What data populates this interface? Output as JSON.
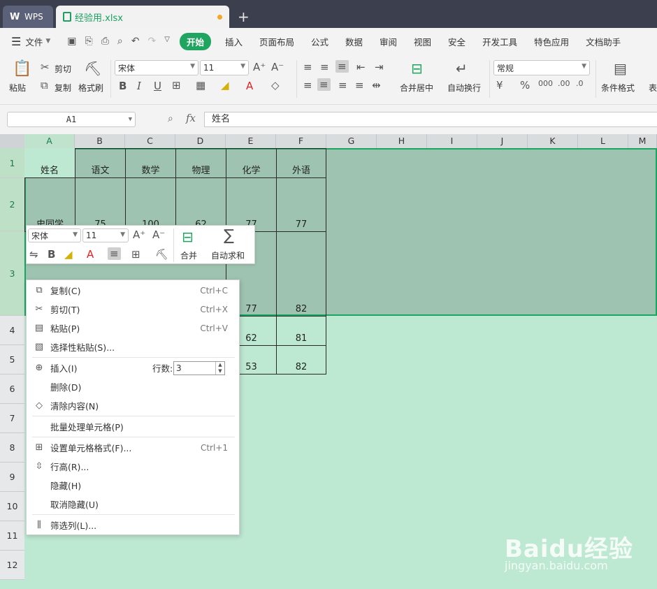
{
  "titlebar": {
    "wps_tab": "WPS",
    "doc_tab": "经验用.xlsx",
    "add_tab": "+"
  },
  "menubar": {
    "file": "文件",
    "start": "开始",
    "items": [
      "插入",
      "页面布局",
      "公式",
      "数据",
      "审阅",
      "视图",
      "安全",
      "开发工具",
      "特色应用",
      "文档助手"
    ]
  },
  "ribbon": {
    "paste": "粘贴",
    "cut": "剪切",
    "copy": "复制",
    "format_painter": "格式刷",
    "font_name": "宋体",
    "font_size": "11",
    "merge_center": "合并居中",
    "wrap_text": "自动换行",
    "number_format": "常规",
    "conditional_format": "条件格式",
    "table_style_partial": "表"
  },
  "formula_bar": {
    "name_box": "A1",
    "fx": "fx",
    "content": "姓名"
  },
  "columns": [
    "A",
    "B",
    "C",
    "D",
    "E",
    "F",
    "G",
    "H",
    "I",
    "J",
    "K",
    "L",
    "M"
  ],
  "rows": [
    "1",
    "2",
    "3",
    "4",
    "5",
    "6",
    "7",
    "8",
    "9",
    "10",
    "11",
    "12"
  ],
  "cells": {
    "headers": [
      "姓名",
      "语文",
      "数学",
      "物理",
      "化学",
      "外语"
    ],
    "row2_partial": [
      "史同学",
      "75",
      "100",
      "62",
      "77",
      "77"
    ],
    "e3": "77",
    "f3": "82",
    "e4": "62",
    "f4": "81",
    "e5": "53",
    "f5": "82"
  },
  "mini_toolbar": {
    "font_name": "宋体",
    "font_size": "11",
    "merge": "合并",
    "autosum": "自动求和"
  },
  "context_menu": {
    "copy": {
      "label": "复制(C)",
      "shortcut": "Ctrl+C"
    },
    "cut": {
      "label": "剪切(T)",
      "shortcut": "Ctrl+X"
    },
    "paste": {
      "label": "粘贴(P)",
      "shortcut": "Ctrl+V"
    },
    "paste_special": {
      "label": "选择性粘贴(S)..."
    },
    "insert": {
      "label": "插入(I)",
      "rows_label": "行数:",
      "rows_value": "3"
    },
    "delete": {
      "label": "删除(D)"
    },
    "clear": {
      "label": "清除内容(N)"
    },
    "batch": {
      "label": "批量处理单元格(P)"
    },
    "format_cells": {
      "label": "设置单元格格式(F)...",
      "shortcut": "Ctrl+1"
    },
    "row_height": {
      "label": "行高(R)..."
    },
    "hide": {
      "label": "隐藏(H)"
    },
    "unhide": {
      "label": "取消隐藏(U)"
    },
    "filter": {
      "label": "筛选列(L)..."
    }
  },
  "watermark": {
    "line1": "Baidu经验",
    "line2": "jingyan.baidu.com"
  },
  "colors": {
    "accent": "#20a561",
    "sheet_bg": "#bde8d1",
    "selection": "#9ec3b0"
  }
}
